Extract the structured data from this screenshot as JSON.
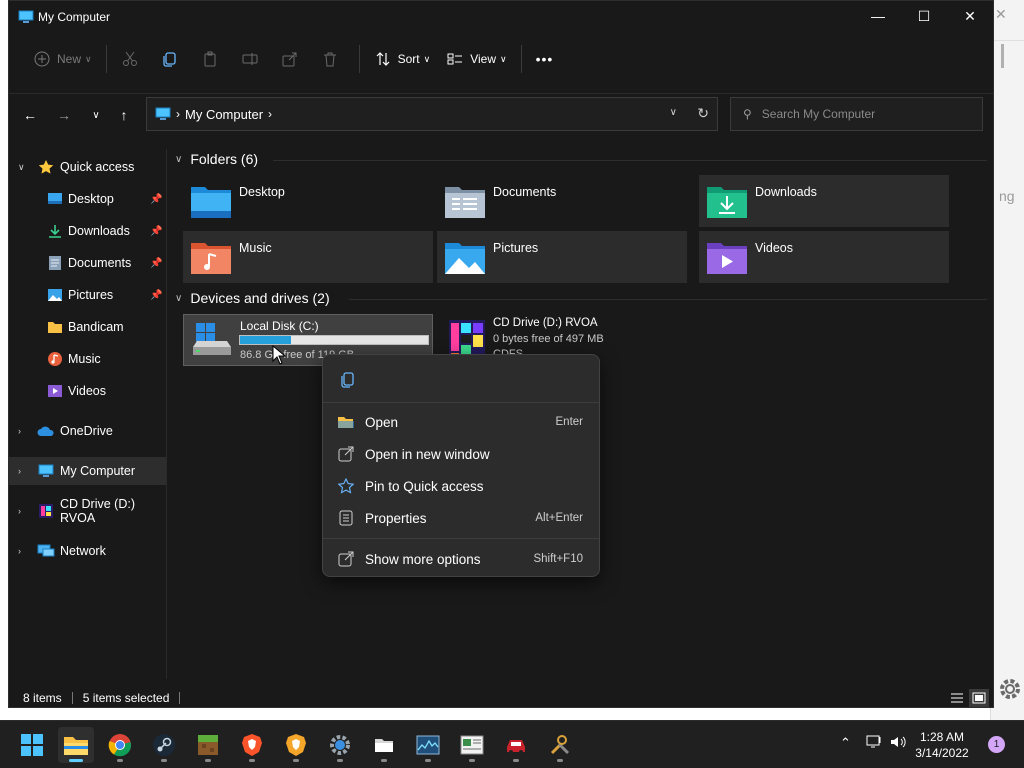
{
  "window": {
    "title": "My Computer"
  },
  "toolbar": {
    "new_label": "New",
    "sort_label": "Sort",
    "view_label": "View",
    "more_label": "•••"
  },
  "address": {
    "crumb": "My Computer",
    "search_placeholder": "Search My Computer"
  },
  "sidebar": {
    "items": [
      {
        "label": "Quick access",
        "icon": "star-icon"
      },
      {
        "label": "Desktop",
        "icon": "desktop-icon"
      },
      {
        "label": "Downloads",
        "icon": "download-icon"
      },
      {
        "label": "Documents",
        "icon": "document-icon"
      },
      {
        "label": "Pictures",
        "icon": "pictures-icon"
      },
      {
        "label": "Bandicam",
        "icon": "folder-icon"
      },
      {
        "label": "Music",
        "icon": "music-icon"
      },
      {
        "label": "Videos",
        "icon": "videos-icon"
      },
      {
        "label": "OneDrive",
        "icon": "cloud-icon"
      },
      {
        "label": "My Computer",
        "icon": "computer-icon"
      },
      {
        "label": "CD Drive (D:) RVOA",
        "icon": "cd-drive-icon"
      },
      {
        "label": "Network",
        "icon": "network-icon"
      }
    ]
  },
  "folders": {
    "header": "Folders (6)",
    "items": [
      {
        "label": "Desktop"
      },
      {
        "label": "Documents"
      },
      {
        "label": "Downloads"
      },
      {
        "label": "Music"
      },
      {
        "label": "Pictures"
      },
      {
        "label": "Videos"
      }
    ]
  },
  "drives": {
    "header": "Devices and drives (2)",
    "local": {
      "name": "Local Disk (C:)",
      "info": "86.8 GB free of 119 GB",
      "used_fraction": 0.27
    },
    "cd": {
      "name": "CD Drive (D:) RVOA",
      "info": "0 bytes free of 497 MB",
      "fs": "CDFS"
    }
  },
  "status": {
    "items_count": "8 items",
    "selected": "5 items selected"
  },
  "context_menu": {
    "items": [
      {
        "label": "Open",
        "shortcut": "Enter",
        "icon": "folder-open-icon"
      },
      {
        "label": "Open in new window",
        "shortcut": "",
        "icon": "new-window-icon"
      },
      {
        "label": "Pin to Quick access",
        "shortcut": "",
        "icon": "star-outline-icon"
      },
      {
        "label": "Properties",
        "shortcut": "Alt+Enter",
        "icon": "properties-icon"
      },
      {
        "label": "Show more options",
        "shortcut": "Shift+F10",
        "icon": "more-options-icon"
      }
    ]
  },
  "background_window": {
    "partial_text": "ng"
  },
  "taskbar": {
    "time": "1:28 AM",
    "date": "3/14/2022",
    "notification_count": "1"
  }
}
